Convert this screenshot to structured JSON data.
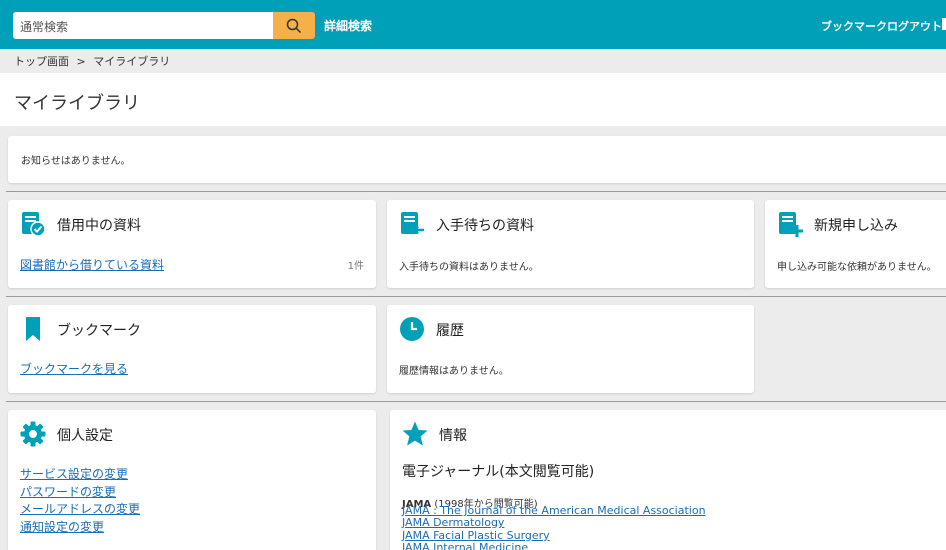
{
  "header": {
    "search_placeholder": "通常検索",
    "advanced_search": "詳細検索",
    "bookmark": "ブックマーク",
    "logout": "ログアウト",
    "accent_color": "#00a0b8",
    "search_button_color": "#f5b04a"
  },
  "breadcrumb": {
    "home": "トップ画面",
    "separator": ">",
    "current": "マイライブラリ"
  },
  "page_title": "マイライブラリ",
  "notice": {
    "text": "お知らせはありません。"
  },
  "cards": {
    "borrowing": {
      "title": "借用中の資料",
      "link": "図書館から借りている資料",
      "count": "1件",
      "icon": "book-check-icon"
    },
    "waiting": {
      "title": "入手待ちの資料",
      "text": "入手待ちの資料はありません。",
      "icon": "book-arrow-icon"
    },
    "new_request": {
      "title": "新規申し込み",
      "text": "申し込み可能な依頼がありません。",
      "icon": "book-plus-icon"
    },
    "bookmark": {
      "title": "ブックマーク",
      "link": "ブックマークを見る",
      "icon": "bookmark-icon"
    },
    "history": {
      "title": "履歴",
      "text": "履歴情報はありません。",
      "icon": "clock-icon"
    },
    "settings": {
      "title": "個人設定",
      "icon": "gear-icon",
      "links": [
        "サービス設定の変更",
        "パスワードの変更",
        "メールアドレスの変更",
        "通知設定の変更"
      ]
    },
    "info": {
      "title": "情報",
      "icon": "star-icon",
      "heading": "電子ジャーナル(本文閲覧可能)",
      "journal_name": "JAMA",
      "journal_note": "(1998年から閲覧可能)",
      "journals": [
        "JAMA : The Journal of the American Medical Association",
        "JAMA Dermatology",
        "JAMA Facial Plastic Surgery",
        "JAMA Internal Medicine"
      ]
    }
  }
}
